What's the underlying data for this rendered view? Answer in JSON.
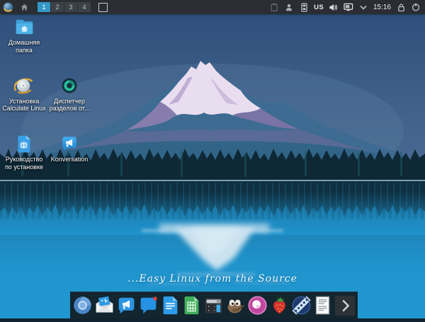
{
  "panel": {
    "launcher_tooltip": "Calculate Linux Menu",
    "pager": [
      "1",
      "2",
      "3",
      "4"
    ],
    "active_desktop": "1",
    "keyboard_layout": "US",
    "clock": "15:16",
    "tray_icons": [
      "clipboard-icon",
      "user-switcher-icon",
      "device-notifier-icon",
      "keyboard-layout",
      "volume-icon",
      "display-icon",
      "expander-chevron-icon",
      "clock",
      "lock-icon",
      "power-icon"
    ]
  },
  "desktop": {
    "icons": [
      {
        "name": "home-folder",
        "line1": "Домашняя",
        "line2": "папка"
      },
      {
        "name": "calculate-installer",
        "line1": "Установка",
        "line2": "Calculate Linux"
      },
      {
        "name": "partition-manager",
        "line1": "Диспетчер",
        "line2": "разделов от..."
      },
      {
        "name": "install-guide",
        "line1": "Руководство",
        "line2": "по установке"
      },
      {
        "name": "konversation",
        "line1": "Konversation",
        "line2": ""
      }
    ]
  },
  "wallpaper": {
    "tagline": "...Easy Linux from the Source"
  },
  "dock": {
    "items": [
      "chromium",
      "kmail",
      "konversation",
      "messenger",
      "libreoffice-writer",
      "libreoffice-calc",
      "kcalc",
      "gimp",
      "media-player",
      "strawberry-player",
      "smplayer",
      "document-viewer",
      "panel-expand-arrow"
    ]
  },
  "colors": {
    "panel_bg": "#2a2e33",
    "active_pager": "#3398c8",
    "accent_blue": "#3daee9",
    "water_bright": "#1f93cc"
  }
}
